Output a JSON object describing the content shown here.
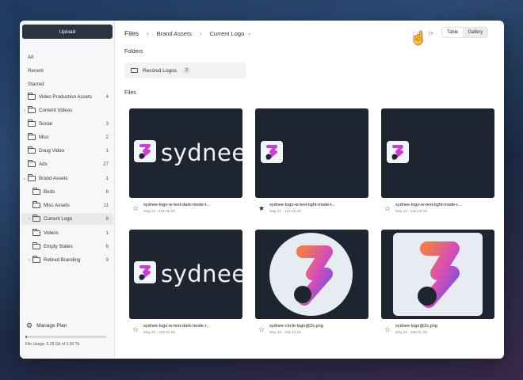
{
  "sidebar": {
    "upload_label": "Upload",
    "quick": [
      "All",
      "Recent",
      "Starred"
    ],
    "items": [
      {
        "label": "Video Production Assets",
        "count": "4",
        "chevron": ""
      },
      {
        "label": "Content Videos",
        "count": "",
        "chevron": "›"
      },
      {
        "label": "Social",
        "count": "3",
        "chevron": ""
      },
      {
        "label": "Misc",
        "count": "2",
        "chevron": ""
      },
      {
        "label": "Doug Video",
        "count": "1",
        "chevron": ""
      },
      {
        "label": "Ads",
        "count": "27",
        "chevron": ""
      },
      {
        "label": "Brand Assets",
        "count": "1",
        "chevron": "⌄"
      },
      {
        "label": "Birds",
        "count": "8",
        "chevron": ""
      },
      {
        "label": "Misc Assets",
        "count": "11",
        "chevron": ""
      },
      {
        "label": "Current Logo",
        "count": "6",
        "chevron": "›"
      },
      {
        "label": "Videos",
        "count": "1",
        "chevron": ""
      },
      {
        "label": "Empty States",
        "count": "6",
        "chevron": ""
      },
      {
        "label": "Retired Branding",
        "count": "9",
        "chevron": "›"
      }
    ],
    "manage_plan": "Manage Plan",
    "usage_text": "File Usage: 5.29 Gb of 3.00 Tb",
    "usage_fraction": 0.02
  },
  "breadcrumb": {
    "root": "Files",
    "level1": "Brand Assets",
    "level2": "Current Logo"
  },
  "view_toggle": {
    "table": "Table",
    "gallery": "Gallery",
    "selected": "Gallery"
  },
  "sections": {
    "folders": "Folders",
    "files": "Files"
  },
  "folder_card": {
    "label": "Resized Logos",
    "count": "2"
  },
  "files": [
    {
      "name": "sydnee-logo-w-text-dark-mode-t...",
      "meta": "May 22 - 131.09 Kb",
      "starred": false,
      "wordmark": "sydnee"
    },
    {
      "name": "sydnee-logo-w-text-light-mode-t...",
      "meta": "May 22 - 131.45 Kb",
      "starred": true,
      "wordmark": ""
    },
    {
      "name": "sydnee-logo-w-text-light-mode-r...",
      "meta": "May 22 - 230.03 Kb",
      "starred": false,
      "wordmark": ""
    },
    {
      "name": "sydnee-logo-w-text-dark-mode-r...",
      "meta": "May 22 - 229.54 Kb",
      "starred": false,
      "wordmark": "sydnee"
    },
    {
      "name": "sydnee-circle-logo@2x.png",
      "meta": "May 22 - 348.10 Kb",
      "starred": false,
      "wordmark": ""
    },
    {
      "name": "sydnee-logo@2x.png",
      "meta": "May 22 - 329.01 Kb",
      "starred": false,
      "wordmark": ""
    }
  ],
  "colors": {
    "accent_dark": "#2b3341",
    "thumb_dark": "#1e2530",
    "logo_pink": "#d94fb4",
    "logo_orange": "#f07a4a",
    "logo_purple": "#7a4fe0"
  }
}
